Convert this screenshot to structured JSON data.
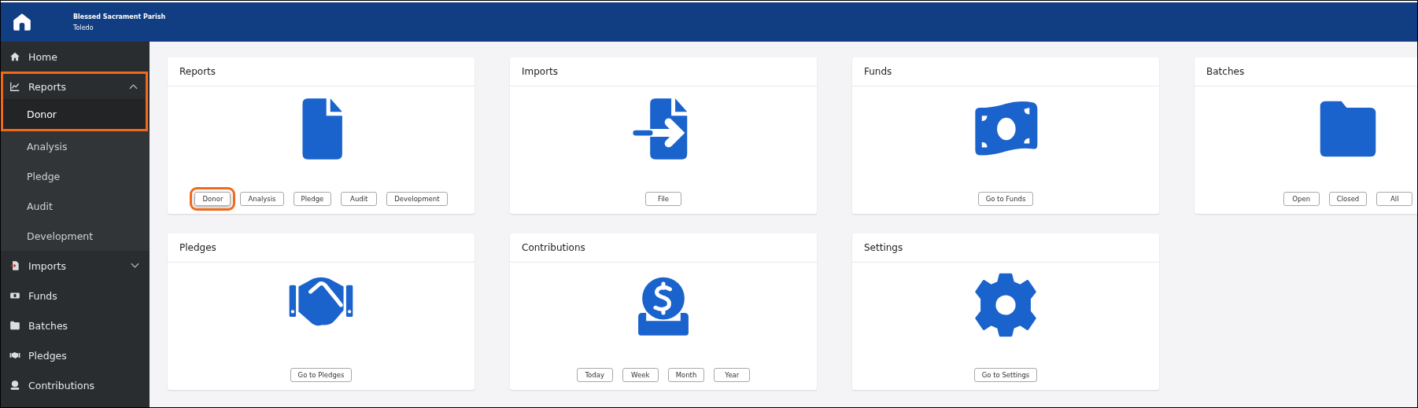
{
  "header": {
    "title": "Blessed Sacrament Parish",
    "subtitle": "Toledo"
  },
  "sidebar": {
    "items": [
      {
        "label": "Home",
        "highlighted": false
      },
      {
        "label": "Reports",
        "expanded": true,
        "highlighted": true,
        "children": [
          {
            "label": "Donor",
            "selected": true,
            "highlighted": true
          },
          {
            "label": "Analysis",
            "selected": false,
            "highlighted": false
          },
          {
            "label": "Pledge",
            "selected": false,
            "highlighted": false
          },
          {
            "label": "Audit",
            "selected": false,
            "highlighted": false
          },
          {
            "label": "Development",
            "selected": false,
            "highlighted": false
          }
        ]
      },
      {
        "label": "Imports",
        "expanded": false,
        "highlighted": false
      },
      {
        "label": "Funds",
        "highlighted": false
      },
      {
        "label": "Batches",
        "highlighted": false
      },
      {
        "label": "Pledges",
        "highlighted": false
      },
      {
        "label": "Contributions",
        "highlighted": false
      }
    ]
  },
  "cards": [
    {
      "title": "Reports",
      "buttons": [
        {
          "label": "Donor",
          "highlighted": true
        },
        {
          "label": "Analysis",
          "highlighted": false
        },
        {
          "label": "Pledge",
          "highlighted": false
        },
        {
          "label": "Audit",
          "highlighted": false
        },
        {
          "label": "Development",
          "highlighted": false
        }
      ]
    },
    {
      "title": "Imports",
      "buttons": [
        {
          "label": "File",
          "highlighted": false
        }
      ]
    },
    {
      "title": "Funds",
      "buttons": [
        {
          "label": "Go to Funds",
          "highlighted": false
        }
      ]
    },
    {
      "title": "Batches",
      "buttons": [
        {
          "label": "Open",
          "highlighted": false
        },
        {
          "label": "Closed",
          "highlighted": false
        },
        {
          "label": "All",
          "highlighted": false
        }
      ]
    },
    {
      "title": "Pledges",
      "buttons": [
        {
          "label": "Go to Pledges",
          "highlighted": false
        }
      ]
    },
    {
      "title": "Contributions",
      "buttons": [
        {
          "label": "Today",
          "highlighted": false
        },
        {
          "label": "Week",
          "highlighted": false
        },
        {
          "label": "Month",
          "highlighted": false
        },
        {
          "label": "Year",
          "highlighted": false
        }
      ]
    },
    {
      "title": "Settings",
      "buttons": [
        {
          "label": "Go to Settings",
          "highlighted": false
        }
      ]
    }
  ]
}
